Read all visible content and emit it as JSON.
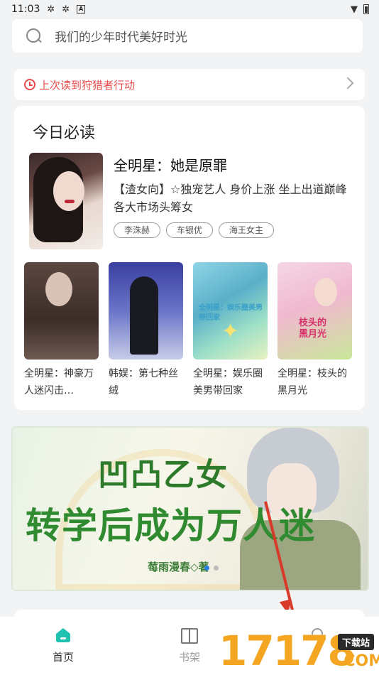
{
  "status_bar": {
    "time": "11:03",
    "box_icon_letter": "A"
  },
  "search": {
    "placeholder": "我们的少年时代美好时光"
  },
  "last_read": {
    "prefix": "上次读到",
    "title": "狩猎者行动",
    "accent": "#e84b4b"
  },
  "today_card": {
    "title": "今日必读",
    "featured": {
      "title": "全明星：她是原罪",
      "description": "【渣女向】☆独宠艺人 身价上涨 坐上出道巅峰各大市场头筹女",
      "tags": [
        "李洙赫",
        "车银优",
        "海王女主"
      ]
    },
    "books": [
      {
        "title": "全明星：神豪万人迷闪击…"
      },
      {
        "title": "韩娱：第七种丝绒"
      },
      {
        "title": "全明星：娱乐圈美男带回家",
        "cover_text": "全明星：娱乐圈美男带回家"
      },
      {
        "title": "全明星：枝头的黑月光",
        "cover_text": "枝头的黑月光"
      }
    ]
  },
  "banner": {
    "title_line_1": "凹凸乙女",
    "title_line_2": "转学后成为万人迷",
    "author": "莓雨漫春◇著",
    "slides": [
      true,
      false
    ]
  },
  "bottom_nav": [
    {
      "label": "首页",
      "icon": "home-icon",
      "active": true
    },
    {
      "label": "书架",
      "icon": "book-icon",
      "active": false
    },
    {
      "label": "",
      "icon": "profile-icon",
      "active": false
    }
  ],
  "watermark": {
    "number": "17178",
    "badge": "下载站",
    "suffix": ".COM"
  },
  "colors": {
    "brand": "#21c1b2",
    "banner_green": "#2f8a30",
    "watermark": "#f4a623"
  }
}
